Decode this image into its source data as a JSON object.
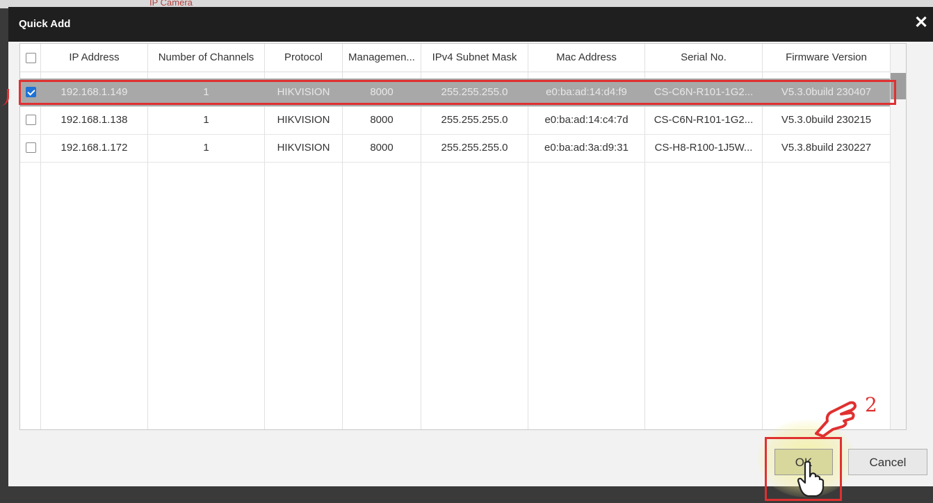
{
  "backdrop": {
    "fragment": "IP Camera"
  },
  "dialog": {
    "title": "Quick Add",
    "close_icon": "close-icon"
  },
  "table": {
    "columns": [
      "IP Address",
      "Number of Channels",
      "Protocol",
      "Managemen...",
      "IPv4 Subnet Mask",
      "Mac Address",
      "Serial No.",
      "Firmware Version"
    ],
    "rows": [
      {
        "checked": true,
        "ip": "192.168.1.149",
        "channels": "1",
        "protocol": "HIKVISION",
        "port": "8000",
        "mask": "255.255.255.0",
        "mac": "e0:ba:ad:14:d4:f9",
        "serial": "CS-C6N-R101-1G2...",
        "firmware": "V5.3.0build 230407"
      },
      {
        "checked": false,
        "ip": "192.168.1.138",
        "channels": "1",
        "protocol": "HIKVISION",
        "port": "8000",
        "mask": "255.255.255.0",
        "mac": "e0:ba:ad:14:c4:7d",
        "serial": "CS-C6N-R101-1G2...",
        "firmware": "V5.3.0build 230215"
      },
      {
        "checked": false,
        "ip": "192.168.1.172",
        "channels": "1",
        "protocol": "HIKVISION",
        "port": "8000",
        "mask": "255.255.255.0",
        "mac": "e0:ba:ad:3a:d9:31",
        "serial": "CS-H8-R100-1J5W...",
        "firmware": "V5.3.8build 230227"
      }
    ]
  },
  "buttons": {
    "ok": "OK",
    "cancel": "Cancel"
  },
  "annotations": {
    "step_number": "2"
  },
  "colors": {
    "accent_red": "#e03030",
    "checkbox_blue": "#1e72d8",
    "selected_row": "#a8a8a8"
  }
}
